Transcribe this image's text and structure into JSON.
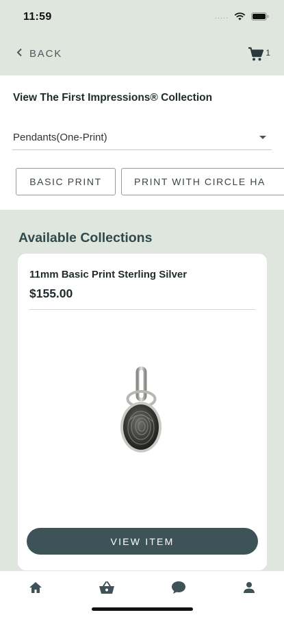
{
  "status_bar": {
    "time": "11:59",
    "signal": "....."
  },
  "nav": {
    "back_label": "BACK",
    "cart_count": "1"
  },
  "filter": {
    "heading": "View The First Impressions® Collection",
    "category_value": "Pendants(One-Print)",
    "chips": [
      "BASIC PRINT",
      "PRINT WITH CIRCLE HA"
    ]
  },
  "collections": {
    "title": "Available Collections",
    "items": [
      {
        "name": "11mm Basic Print Sterling Silver",
        "price": "$155.00",
        "button_label": "VIEW ITEM"
      }
    ]
  },
  "tabs": [
    "home-icon",
    "shopping-basket-icon",
    "chat-bubble-icon",
    "account-icon"
  ],
  "colors": {
    "background": "#dfe6de",
    "accent": "#3d5358",
    "section_title": "#2f4a4e"
  }
}
